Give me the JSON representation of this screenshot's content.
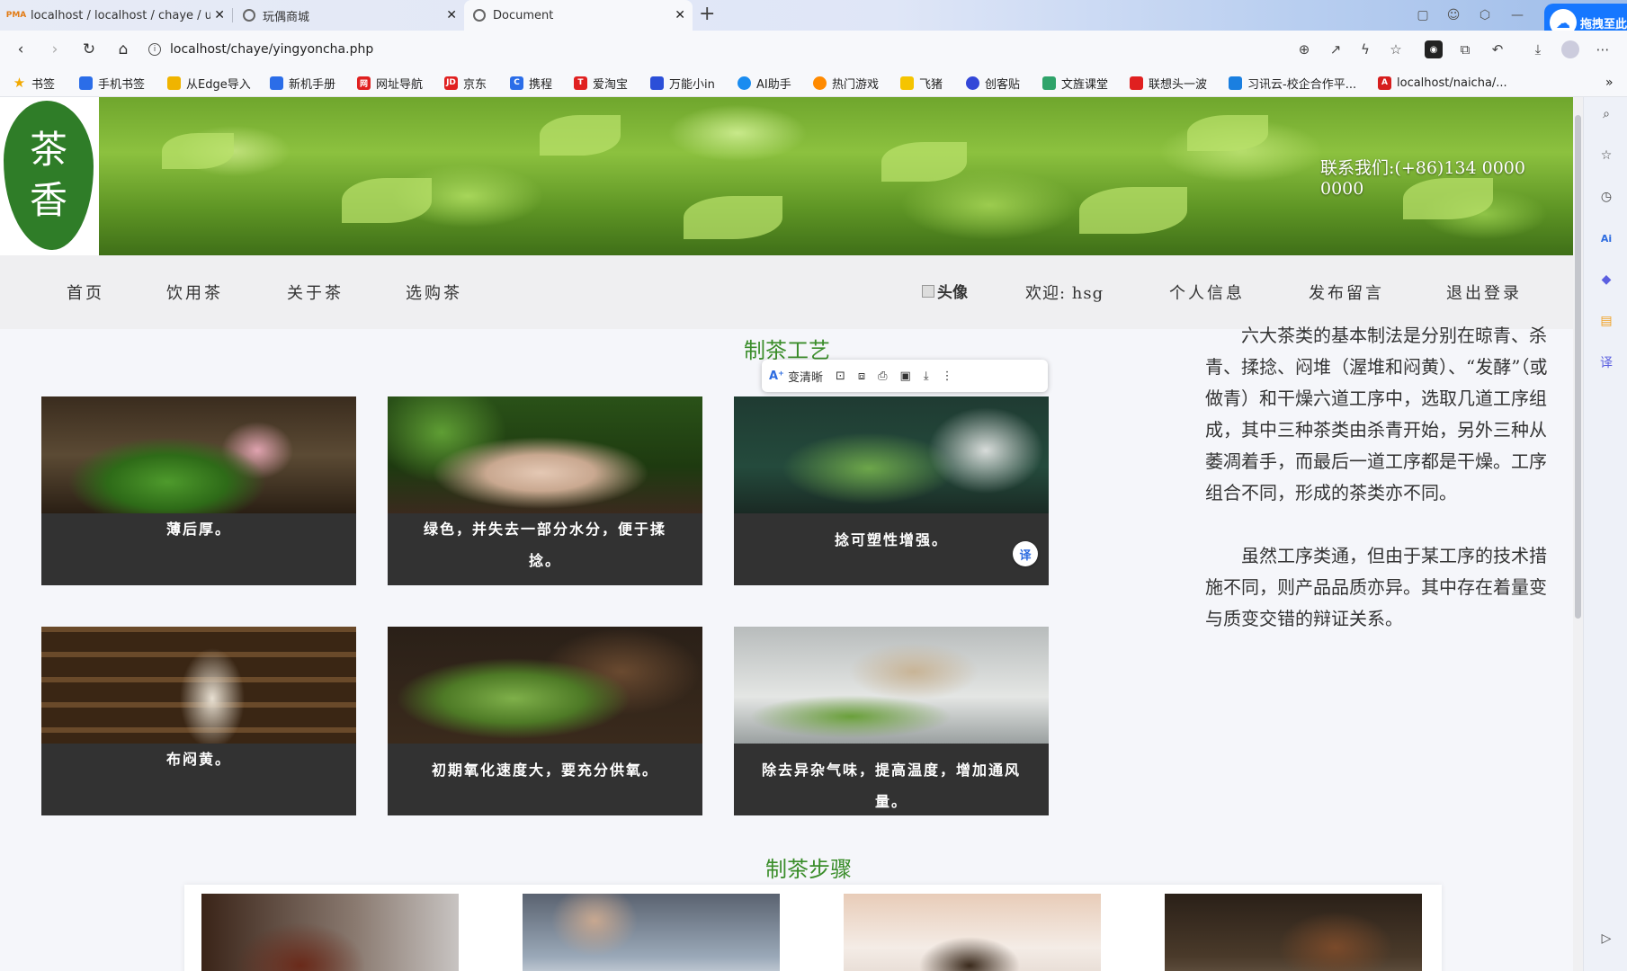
{
  "browser": {
    "tabs": [
      {
        "title": "localhost / localhost / chaye / u",
        "favicon": "pma-icon"
      },
      {
        "title": "玩偶商城",
        "favicon": "edge-page-icon"
      },
      {
        "title": "Document",
        "favicon": "edge-page-icon"
      }
    ],
    "url": "localhost/chaye/yingyoncha.php",
    "baidu_label": "拖拽至此",
    "bookmarks": [
      {
        "label": "书签",
        "color": "#f2a900"
      },
      {
        "label": "手机书签",
        "color": "#2b6de8"
      },
      {
        "label": "从Edge导入",
        "color": "#f0b400"
      },
      {
        "label": "新机手册",
        "color": "#2b6de8"
      },
      {
        "label": "网址导航",
        "color": "#e02020"
      },
      {
        "label": "京东",
        "color": "#e02020"
      },
      {
        "label": "携程",
        "color": "#2b6de8"
      },
      {
        "label": "爱淘宝",
        "color": "#e02020"
      },
      {
        "label": "万能小in",
        "color": "#2b4fd8"
      },
      {
        "label": "AI助手",
        "color": "#1a8cf0"
      },
      {
        "label": "热门游戏",
        "color": "#ff8a00"
      },
      {
        "label": "飞猪",
        "color": "#f5c400"
      },
      {
        "label": "创客贴",
        "color": "#3347d8"
      },
      {
        "label": "文旌课堂",
        "color": "#2fa36a"
      },
      {
        "label": "联想头一波",
        "color": "#e02020"
      },
      {
        "label": "习讯云-校企合作平...",
        "color": "#1a7fe0"
      },
      {
        "label": "localhost/naicha/...",
        "color": "#d61e1e"
      }
    ]
  },
  "site": {
    "logo_text": [
      "茶",
      "香"
    ],
    "contact": "联系我们:(+86)134 0000 0000",
    "nav_left": [
      "首页",
      "饮用茶",
      "关于茶",
      "选购茶"
    ],
    "avatar_alt": "头像",
    "welcome": "欢迎: hsg",
    "nav_right": [
      "个人信息",
      "发布留言",
      "退出登录"
    ]
  },
  "craft": {
    "title": "制茶工艺",
    "cards": [
      {
        "caption": "薄后厚。"
      },
      {
        "caption": "绿色，并失去一部分水分，便于揉捻。"
      },
      {
        "caption": "捻可塑性增强。"
      },
      {
        "caption": "布闷黄。"
      },
      {
        "caption": "初期氧化速度大，要充分供氧。"
      },
      {
        "caption": "除去异杂气味，提高温度，增加通风量。"
      }
    ],
    "desc_p1": "六大茶类的基本制法是分别在晾青、杀青、揉捻、闷堆（渥堆和闷黄）、“发酵”（或做青）和干燥六道工序中，选取几道工序组成，其中三种茶类由杀青开始，另外三种从萎凋着手，而最后一道工序都是干燥。工序组合不同，形成的茶类亦不同。",
    "desc_p2": "虽然工序类通，但由于某工序的技术措施不同，则产品品质亦异。其中存在着量变与质变交错的辩证关系。"
  },
  "image_toolbar": {
    "enhance": "变清晰"
  },
  "translate_badge": "译",
  "steps": {
    "title": "制茶步骤"
  },
  "colors": {
    "accent_green": "#3a8d2a",
    "card_bg": "#323232",
    "nav_bg": "#efeff1"
  }
}
